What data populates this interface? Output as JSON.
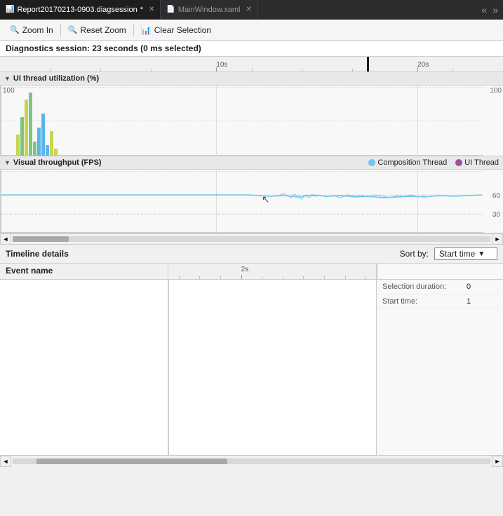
{
  "tabs": [
    {
      "id": "diag",
      "label": "Report20170213-0903.diagsession",
      "modified": true,
      "active": true
    },
    {
      "id": "xaml",
      "label": "MainWindow.xaml",
      "modified": false,
      "active": false
    }
  ],
  "toolbar": {
    "zoom_in_label": "Zoom In",
    "reset_zoom_label": "Reset Zoom",
    "clear_selection_label": "Clear Selection"
  },
  "status": {
    "text": "Diagnostics session: 23 seconds (0 ms selected)"
  },
  "time_ruler": {
    "marks": [
      "10s",
      "20s"
    ],
    "mark_positions": [
      43,
      84
    ]
  },
  "ui_thread_chart": {
    "title": "UI thread utilization (%)",
    "y_labels": [
      "100",
      ""
    ],
    "y_labels_right": [
      "100",
      ""
    ]
  },
  "fps_chart": {
    "title": "Visual throughput (FPS)",
    "legend": [
      {
        "label": "Composition Thread",
        "color": "#6ec6f0"
      },
      {
        "label": "UI Thread",
        "color": "#9b4f9b"
      }
    ],
    "y_labels_right": [
      "60",
      "30"
    ],
    "line_y_60": 40,
    "line_y_30": 70
  },
  "bottom_panel": {
    "title": "Timeline details",
    "sort_label": "Sort by:",
    "sort_value": "Start time",
    "col_event_name": "Event name",
    "timeline_mark": "2s",
    "details": [
      {
        "label": "Selection duration:",
        "value": "0"
      },
      {
        "label": "Start time:",
        "value": "1"
      }
    ]
  },
  "icons": {
    "zoom_in": "🔍",
    "reset_zoom": "🔍",
    "clear_selection": "✕",
    "collapse_arrow": "▼",
    "tab_close": "✕",
    "nav_left": "«",
    "nav_right": "»",
    "scroll_left": "◄",
    "scroll_right": "►",
    "dropdown_arrow": "▼"
  }
}
